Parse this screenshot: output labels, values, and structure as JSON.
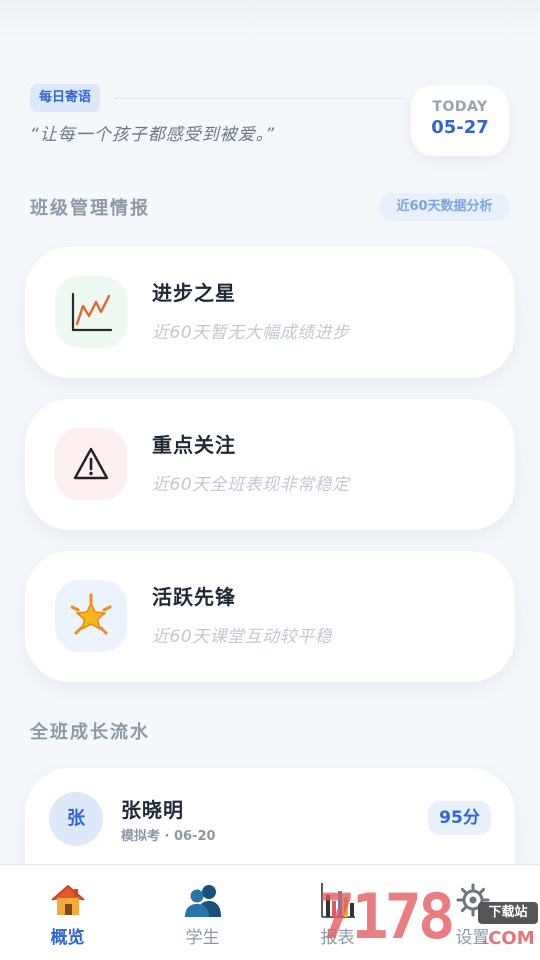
{
  "quote": {
    "tag": "每日寄语",
    "text": "“让每一个孩子都感受到被爱。”"
  },
  "date": {
    "label": "TODAY",
    "value": "05-27"
  },
  "management": {
    "title": "班级管理情报",
    "badge": "近60天数据分析",
    "cards": [
      {
        "title": "进步之星",
        "subtitle": "近60天暂无大幅成绩进步",
        "icon": "chart-up-icon",
        "tint": "#edf9f1"
      },
      {
        "title": "重点关注",
        "subtitle": "近60天全班表现非常稳定",
        "icon": "warning-icon",
        "tint": "#fdf0f0"
      },
      {
        "title": "活跃先锋",
        "subtitle": "近60天课堂互动较平稳",
        "icon": "sparkle-star-icon",
        "tint": "#edf3fd"
      }
    ]
  },
  "timeline": {
    "title": "全班成长流水",
    "entries": [
      {
        "avatar": "张",
        "name": "张晓明",
        "meta": "模拟考 · 06-20",
        "score": "95分"
      }
    ]
  },
  "nav": [
    {
      "label": "概览",
      "icon": "house-icon",
      "active": true
    },
    {
      "label": "学生",
      "icon": "users-icon",
      "active": false
    },
    {
      "label": "报表",
      "icon": "bar-chart-icon",
      "active": false
    },
    {
      "label": "设置",
      "icon": "gear-icon",
      "active": false
    }
  ],
  "watermark": {
    "digits": "7178",
    "badge": "下载站",
    "domain": ".COM"
  },
  "colors": {
    "accent": "#2f66d6",
    "muted": "#8e99a8",
    "background": "#f5f8fb"
  }
}
